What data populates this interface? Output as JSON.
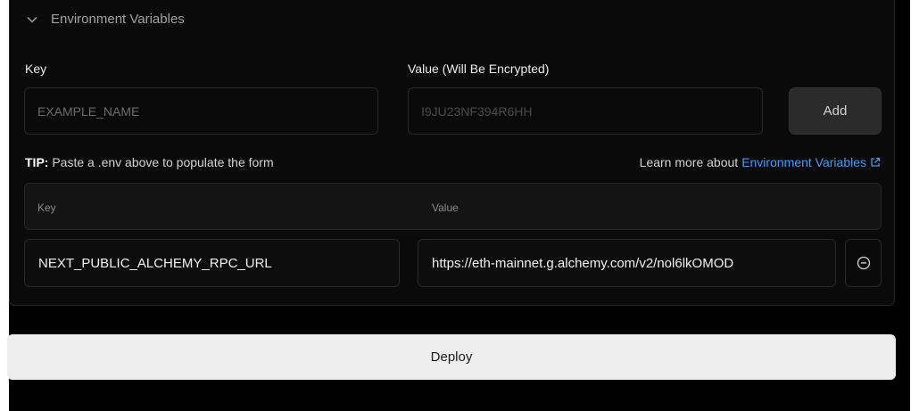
{
  "env_section": {
    "title": "Environment Variables",
    "key_label": "Key",
    "value_label": "Value (Will Be Encrypted)",
    "key_placeholder": "EXAMPLE_NAME",
    "value_placeholder": "I9JU23NF394R6HH",
    "add_label": "Add",
    "tip_prefix": "TIP:",
    "tip_text": "Paste a .env above to populate the form",
    "learn_prefix": "Learn more about",
    "learn_link": "Environment Variables",
    "table": {
      "col_key": "Key",
      "col_value": "Value",
      "rows": [
        {
          "key": "NEXT_PUBLIC_ALCHEMY_RPC_URL",
          "value": "https://eth-mainnet.g.alchemy.com/v2/nol6lkOMOD"
        }
      ]
    }
  },
  "deploy_label": "Deploy",
  "icons": {
    "section_toggle": "chevron-down-icon",
    "learn_link": "external-link-icon",
    "remove_row": "minus-circle-icon"
  },
  "colors": {
    "background": "#000000",
    "link": "#3b9eff",
    "deploy_bg": "#ededed"
  }
}
